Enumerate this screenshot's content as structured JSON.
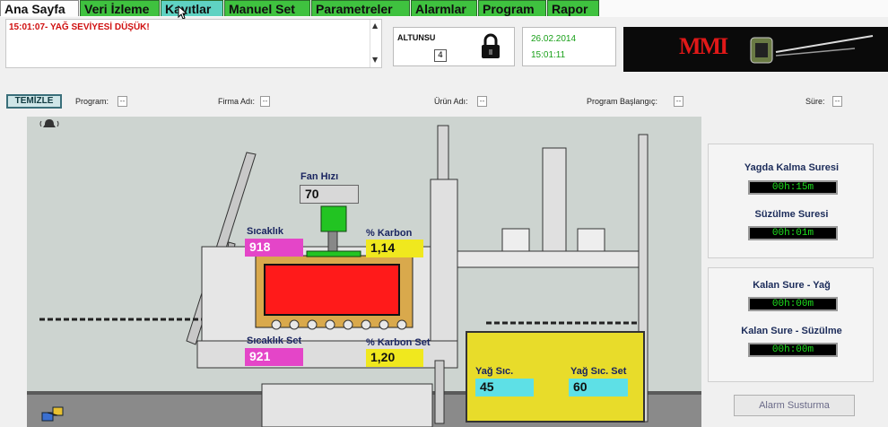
{
  "tabs": [
    {
      "label": "Ana Sayfa"
    },
    {
      "label": "Veri İzleme"
    },
    {
      "label": "Kayıtlar"
    },
    {
      "label": "Manuel Set"
    },
    {
      "label": "Parametreler"
    },
    {
      "label": "Alarmlar"
    },
    {
      "label": "Program"
    },
    {
      "label": "Rapor"
    }
  ],
  "alarm_message": "15:01:07- YAĞ SEVİYESİ DÜŞÜK!",
  "altunsu": {
    "label": "ALTUNSU",
    "value": "4"
  },
  "datetime": {
    "date": "26.02.2014",
    "time": "15:01:11"
  },
  "logo_text": "MMI",
  "clear_button": "TEMİZLE",
  "filters": [
    {
      "label": "Program:",
      "value": "--"
    },
    {
      "label": "Firma Adı:",
      "value": "--"
    },
    {
      "label": "Ürün Adı:",
      "value": "--"
    },
    {
      "label": "Program Başlangıç:",
      "value": "--"
    },
    {
      "label": "Süre:",
      "value": "--"
    }
  ],
  "process": {
    "fan_label": "Fan Hızı",
    "fan_value": "70",
    "temp_label": "Sıcaklık",
    "temp_value": "918",
    "carbon_label": "% Karbon",
    "carbon_value": "1,14",
    "temp_set_label": "Sıcaklık Set",
    "temp_set_value": "921",
    "carbon_set_label": "% Karbon Set",
    "carbon_set_value": "1,20",
    "oil_temp_label": "Yağ Sıc.",
    "oil_temp_value": "45",
    "oil_set_label": "Yağ Sıc. Set",
    "oil_set_value": "60"
  },
  "timers": [
    {
      "label": "Yagda Kalma Suresi",
      "value": "00h:15m"
    },
    {
      "label": "Süzülme Suresi",
      "value": "00h:01m"
    },
    {
      "label": "Kalan Sure - Yağ",
      "value": "00h:00m"
    },
    {
      "label": "Kalan Sure - Süzülme",
      "value": "00h:00m"
    }
  ],
  "alarm_silence_button": "Alarm Susturma",
  "colors": {
    "tab_green": "#3fc23f",
    "alarm_red": "#d01010",
    "timer_green": "#1de01d",
    "heat_red": "#ff1a1a"
  }
}
